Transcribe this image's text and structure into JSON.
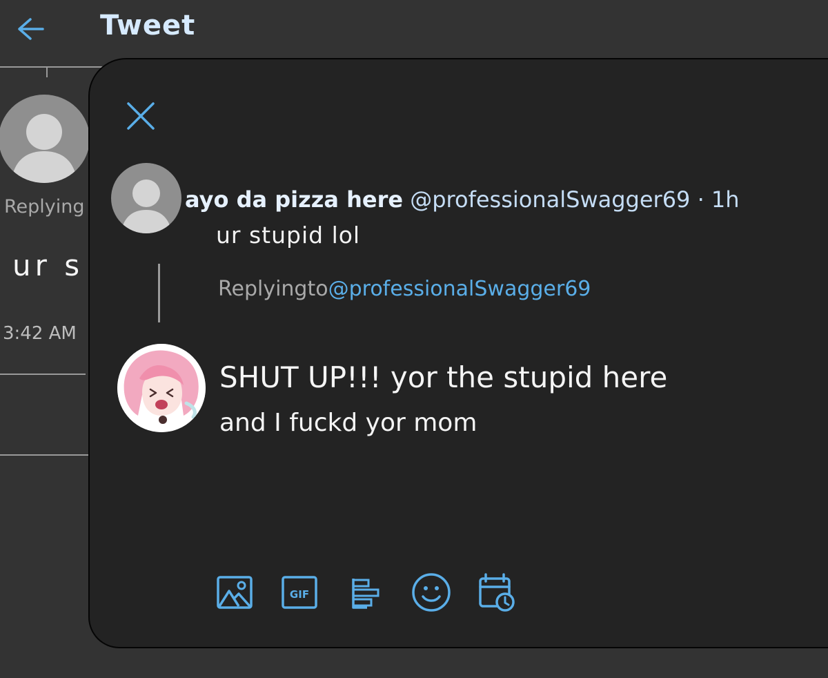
{
  "header": {
    "title": "Tweet"
  },
  "background_tweet": {
    "replying_text": "Replying",
    "text": "ur s",
    "time": "3:42 AM"
  },
  "reply_modal": {
    "original_tweet": {
      "display_name": "ayo da pizza here",
      "handle": "@professionalSwagger69",
      "separator": "·",
      "time": "1h",
      "text": "ur stupid lol"
    },
    "replying_to_label": "Replyingto",
    "replying_to_handle": "@professionalSwagger69",
    "reply_text_line1": "SHUT UP!!! yor the stupid here",
    "reply_text_line2": "and I fuckd yor mom",
    "toolbar_icons": [
      "image-icon",
      "gif-icon",
      "poll-icon",
      "emoji-icon",
      "schedule-icon"
    ]
  },
  "colors": {
    "background": "#333333",
    "modal": "#232323",
    "accent": "#5aaee8",
    "title": "#d6eaff"
  }
}
